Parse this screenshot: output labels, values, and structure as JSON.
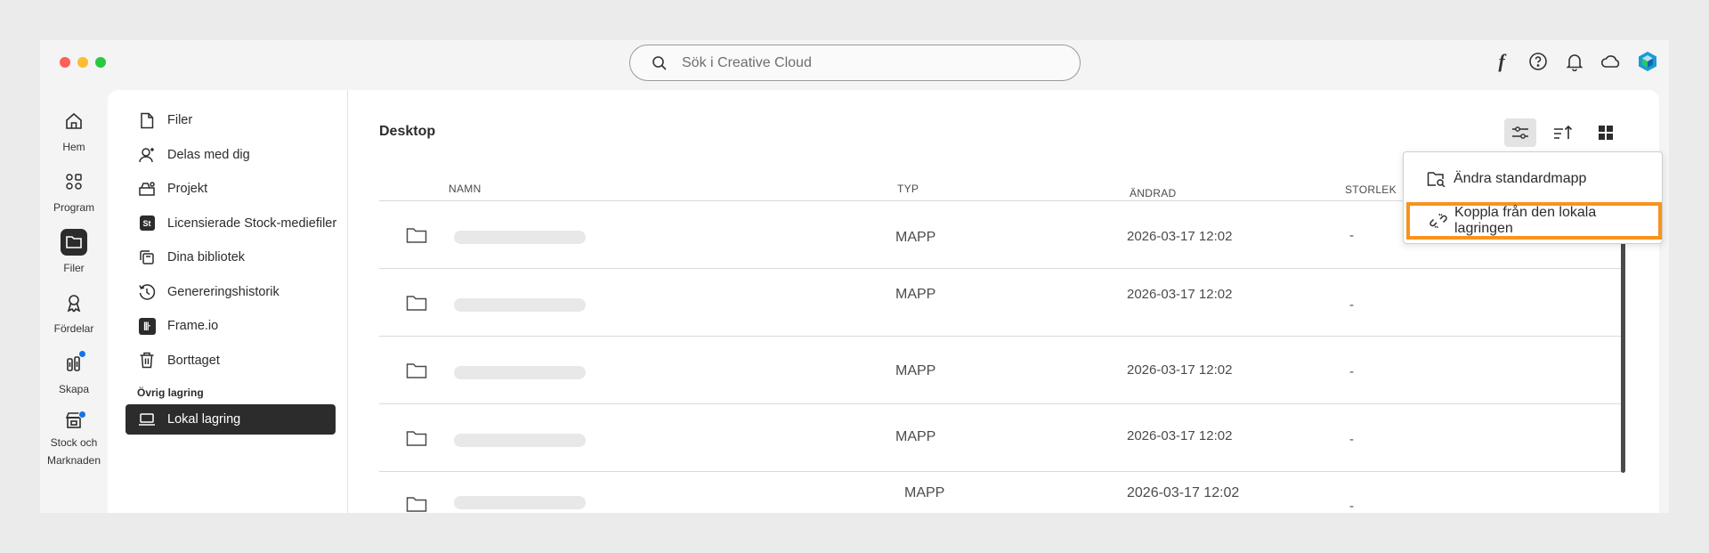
{
  "search": {
    "placeholder": "Sök i Creative Cloud"
  },
  "topbar": {
    "icons": [
      "font-icon",
      "help-icon",
      "bell-icon",
      "cloud-icon",
      "app-logo-icon"
    ],
    "font_glyph": "f"
  },
  "rail": {
    "items": [
      {
        "label": "Hem",
        "icon": "home-icon"
      },
      {
        "label": "Program",
        "icon": "apps-icon"
      },
      {
        "label": "Filer",
        "icon": "folder-icon",
        "active": true
      },
      {
        "label": "Fördelar",
        "icon": "ribbon-icon"
      },
      {
        "label": "Skapa",
        "icon": "create-icon",
        "badge": true
      },
      {
        "label": "Stock och Marknaden",
        "icon": "store-icon",
        "badge": true
      }
    ]
  },
  "sidebar": {
    "items": [
      {
        "label": "Filer",
        "icon": "file-icon"
      },
      {
        "label": "Delas med dig",
        "icon": "shared-icon"
      },
      {
        "label": "Projekt",
        "icon": "project-icon"
      },
      {
        "label": "Licensierade Stock-mediefiler",
        "icon": "stock-icon",
        "badge_text": "St"
      },
      {
        "label": "Dina bibliotek",
        "icon": "library-icon"
      },
      {
        "label": "Genereringshistorik",
        "icon": "history-icon"
      },
      {
        "label": "Frame.io",
        "icon": "frameio-icon",
        "badge_text": "|||·"
      },
      {
        "label": "Borttaget",
        "icon": "trash-icon"
      }
    ],
    "section_label": "Övrig lagring",
    "selected_item": {
      "label": "Lokal lagring",
      "icon": "laptop-icon"
    }
  },
  "content": {
    "title": "Desktop",
    "columns": {
      "name": "NAMN",
      "type": "TYP",
      "modified": "ÄNDRAD",
      "size": "STORLEK"
    },
    "rows": [
      {
        "type": "MAPP",
        "modified": "2026-03-17 12:02",
        "size": "-"
      },
      {
        "type": "MAPP",
        "modified": "2026-03-17 12:02",
        "size": "-"
      },
      {
        "type": "MAPP",
        "modified": "2026-03-17 12:02",
        "size": "-"
      },
      {
        "type": "MAPP",
        "modified": "2026-03-17 12:02",
        "size": "-"
      },
      {
        "type": "MAPP",
        "modified": "2026-03-17 12:02",
        "size": "-"
      }
    ]
  },
  "toolbar": {
    "buttons": [
      "filter-icon",
      "sort-icon",
      "grid-view-icon"
    ]
  },
  "dropdown": {
    "items": [
      {
        "label": "Ändra standardmapp",
        "icon": "folder-search-icon"
      },
      {
        "label": "Koppla från den lokala lagringen",
        "icon": "unlink-icon",
        "highlighted": true
      }
    ],
    "highlight_color": "#f7931e"
  },
  "colors": {
    "accent": "#1473e6",
    "selected_bg": "#2c2c2c",
    "highlight": "#f7931e"
  }
}
